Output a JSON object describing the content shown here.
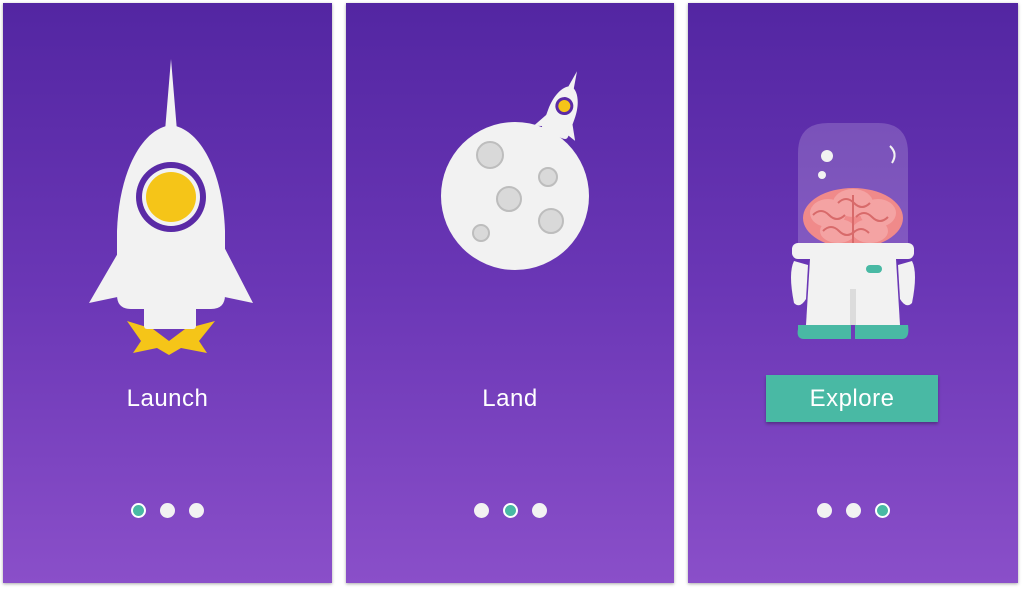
{
  "colors": {
    "gradient_top": "#5326a2",
    "gradient_bottom": "#8a4fc9",
    "accent_teal": "#49b9a4",
    "accent_yellow": "#f5c518",
    "white": "#f2f2f2"
  },
  "screens": [
    {
      "label": "Launch",
      "illustration": "rocket-launch-icon",
      "active_dot": 1,
      "dots": [
        "page-1",
        "page-2",
        "page-3"
      ]
    },
    {
      "label": "Land",
      "illustration": "moon-landing-icon",
      "active_dot": 2,
      "dots": [
        "page-1",
        "page-2",
        "page-3"
      ]
    },
    {
      "label": "Explore",
      "illustration": "astronaut-brain-icon",
      "active_dot": 3,
      "is_button": true,
      "dots": [
        "page-1",
        "page-2",
        "page-3"
      ]
    }
  ]
}
